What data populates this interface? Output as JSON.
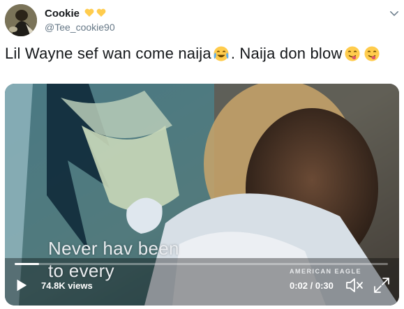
{
  "tweet": {
    "display_name": "Cookie",
    "name_emojis": [
      "yellow-heart-emoji",
      "yellow-heart-emoji"
    ],
    "handle": "@Tee_cookie90",
    "text_part1": "Lil Wayne sef wan come naija",
    "text_part2": ". Naija don blow",
    "text_emojis": [
      "tears-of-joy-emoji",
      "savoring-food-emoji",
      "savoring-food-emoji"
    ],
    "more_icon": "chevron-down-icon"
  },
  "video": {
    "caption_line1": "Never hav          been",
    "caption_line2": "to every",
    "brand_watermark": "AMERICAN EAGLE",
    "views": "74.8K views",
    "time": "0:02 / 0:30",
    "progress": 0.066,
    "icons": {
      "play": "play-icon",
      "mute": "muted-speaker-icon",
      "fullscreen": "fullscreen-icon"
    }
  },
  "colors": {
    "handle": "#657786",
    "text": "#14171a",
    "heart": "#ffcc4d"
  }
}
